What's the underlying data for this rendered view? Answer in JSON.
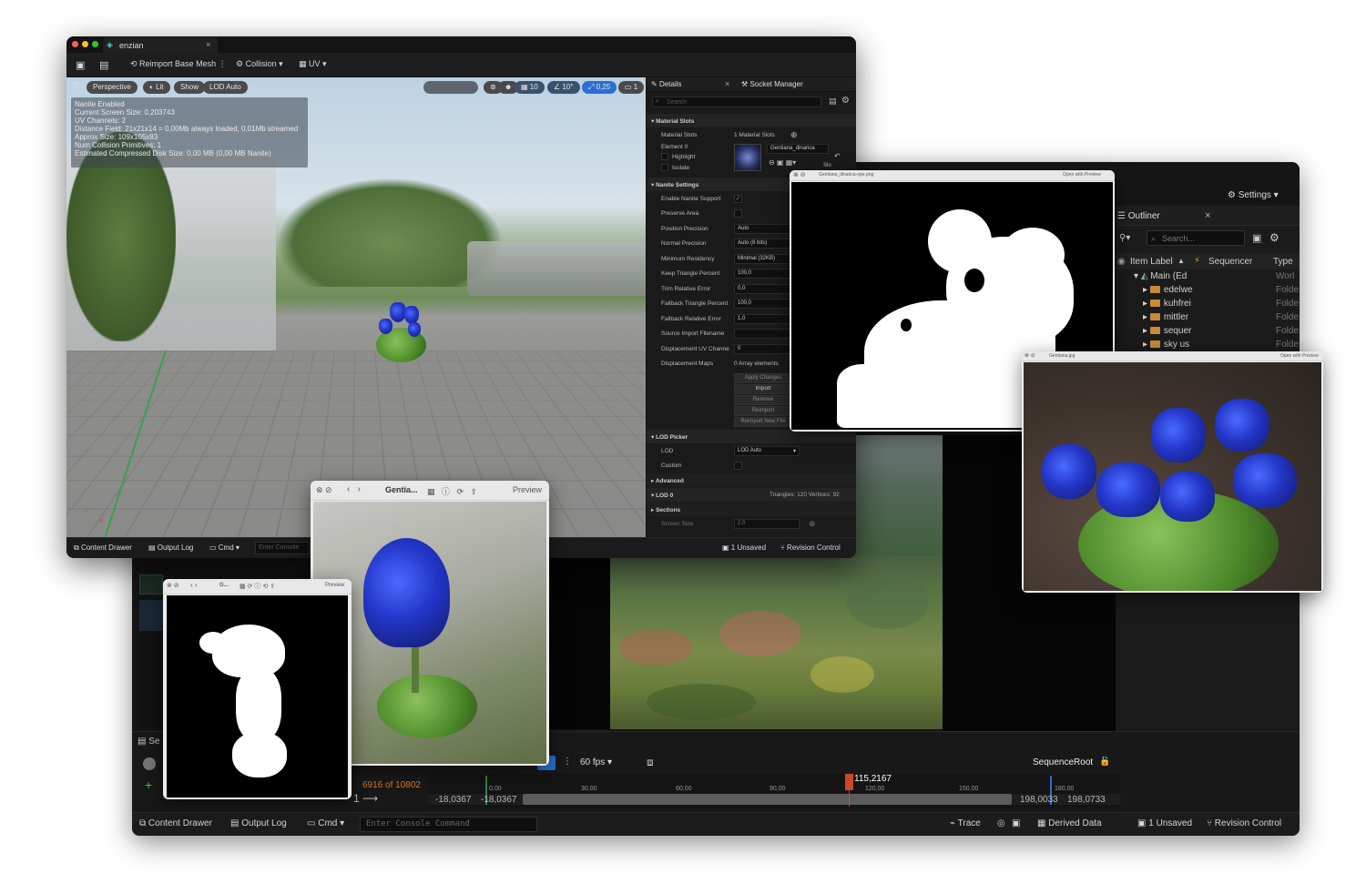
{
  "front_window": {
    "tab_title": "enzian",
    "toolbar": {
      "reimport": "Reimport Base Mesh",
      "collision": "Collision",
      "uv": "UV"
    },
    "viewport": {
      "chips": [
        "Perspective",
        "Lit",
        "Show",
        "LOD Auto"
      ],
      "right_chips": [
        "10",
        "10°",
        "0,25",
        "1"
      ],
      "info_lines": [
        "Nanite Enabled",
        "Current Screen Size:  0,203743",
        "UV Channels:  2",
        "Distance Field:  21x21x14 = 0,00Mb always loaded, 0,01Mb streamed",
        "Approx Size: 109x105x83",
        "Num Collision Primitives:  1",
        "Estimated Compressed Disk Size: 0,00 MB (0,00 MB Nanite)"
      ],
      "axis_z": "z",
      "axis_x": "x"
    },
    "details": {
      "tab_details": "Details",
      "tab_socket": "Socket Manager",
      "search_placeholder": "Search",
      "sections": {
        "material_slots": "Material Slots",
        "nanite": "Nanite Settings",
        "lod_picker": "LOD Picker",
        "advanced": "Advanced",
        "lod0": "LOD 0",
        "sections": "Sections"
      },
      "material_slots_label": "Material Slots",
      "material_slots_value": "1 Material Slots",
      "element0": "Element 0",
      "highlight": "Highlight",
      "isolate": "Isolate",
      "material_name": "Gentiana_dinarica",
      "slo": "Slo",
      "rows": [
        {
          "label": "Enable Nanite Support",
          "value": ""
        },
        {
          "label": "Preserve Area",
          "value": ""
        },
        {
          "label": "Position Precision",
          "value": "Auto"
        },
        {
          "label": "Normal Precision",
          "value": "Auto (8 bits)"
        },
        {
          "label": "Minimum Residency",
          "value": "Minimal (32KB)"
        },
        {
          "label": "Keep Triangle Percent",
          "value": "100,0"
        },
        {
          "label": "Trim Relative Error",
          "value": "0,0"
        },
        {
          "label": "Fallback Triangle Percent",
          "value": "100,0"
        },
        {
          "label": "Fallback Relative Error",
          "value": "1,0"
        },
        {
          "label": "Source Import Filename",
          "value": ""
        },
        {
          "label": "Displacement UV Channe",
          "value": "0"
        },
        {
          "label": "Displacement Maps",
          "value": "0 Array elements"
        }
      ],
      "buttons": [
        "Apply Changes",
        "Import",
        "Remove",
        "Reimport",
        "Reimport New File"
      ],
      "lod_label": "LOD",
      "lod_value": "LOD Auto",
      "custom": "Custom",
      "lod0_stats": "Triangles: 120   Vertices: 92",
      "screen_size_label": "Screen Size",
      "screen_size_value": "2,0"
    },
    "status": {
      "content_drawer": "Content Drawer",
      "output_log": "Output Log",
      "cmd": "Cmd",
      "console_placeholder": "Enter Console",
      "unsaved": "1 Unsaved",
      "revision": "Revision Control"
    }
  },
  "back_window": {
    "settings": "Settings",
    "outliner": {
      "title": "Outliner",
      "search_placeholder": "Search...",
      "col_label": "Item Label",
      "col_sequencer": "Sequencer",
      "col_type": "Type",
      "rows": [
        {
          "label": "Main (Ed",
          "type": "Worl"
        },
        {
          "label": "edelwe",
          "type": "Folde"
        },
        {
          "label": "kuhfrei",
          "type": "Folde"
        },
        {
          "label": "mittler",
          "type": "Folde"
        },
        {
          "label": "sequer",
          "type": "Folde"
        },
        {
          "label": "sky us",
          "type": "Folde"
        }
      ]
    },
    "sequencer": {
      "fps": "60 fps",
      "root": "SequenceRoot",
      "frames": "6916 of 10802",
      "current_time": "115,2167",
      "start_outer": "-18,0367",
      "start_inner": "-18,0367",
      "end_inner": "198,0033",
      "end_outer": "198,0733",
      "ticks": [
        "0,00",
        "30,00",
        "60,00",
        "90,00",
        "120,00",
        "150,00",
        "180,00"
      ],
      "left_num": "11",
      "se_label": "Se"
    },
    "status": {
      "content_drawer": "Content Drawer",
      "output_log": "Output Log",
      "cmd": "Cmd",
      "console_placeholder": "Enter Console Command",
      "trace": "Trace",
      "derived": "Derived Data",
      "unsaved": "1 Unsaved",
      "revision": "Revision Control"
    }
  },
  "previews": {
    "mask_large": {
      "title": "Gentiana_dinarica-ope.png",
      "right": "Open with Preview"
    },
    "photo_large": {
      "title": "Gentiana.jpg",
      "right": "Open with Preview"
    },
    "photo_mid": {
      "title": "Gentia...",
      "right": "Preview"
    },
    "mask_small": {
      "title": "G...",
      "right": "Preview"
    }
  }
}
